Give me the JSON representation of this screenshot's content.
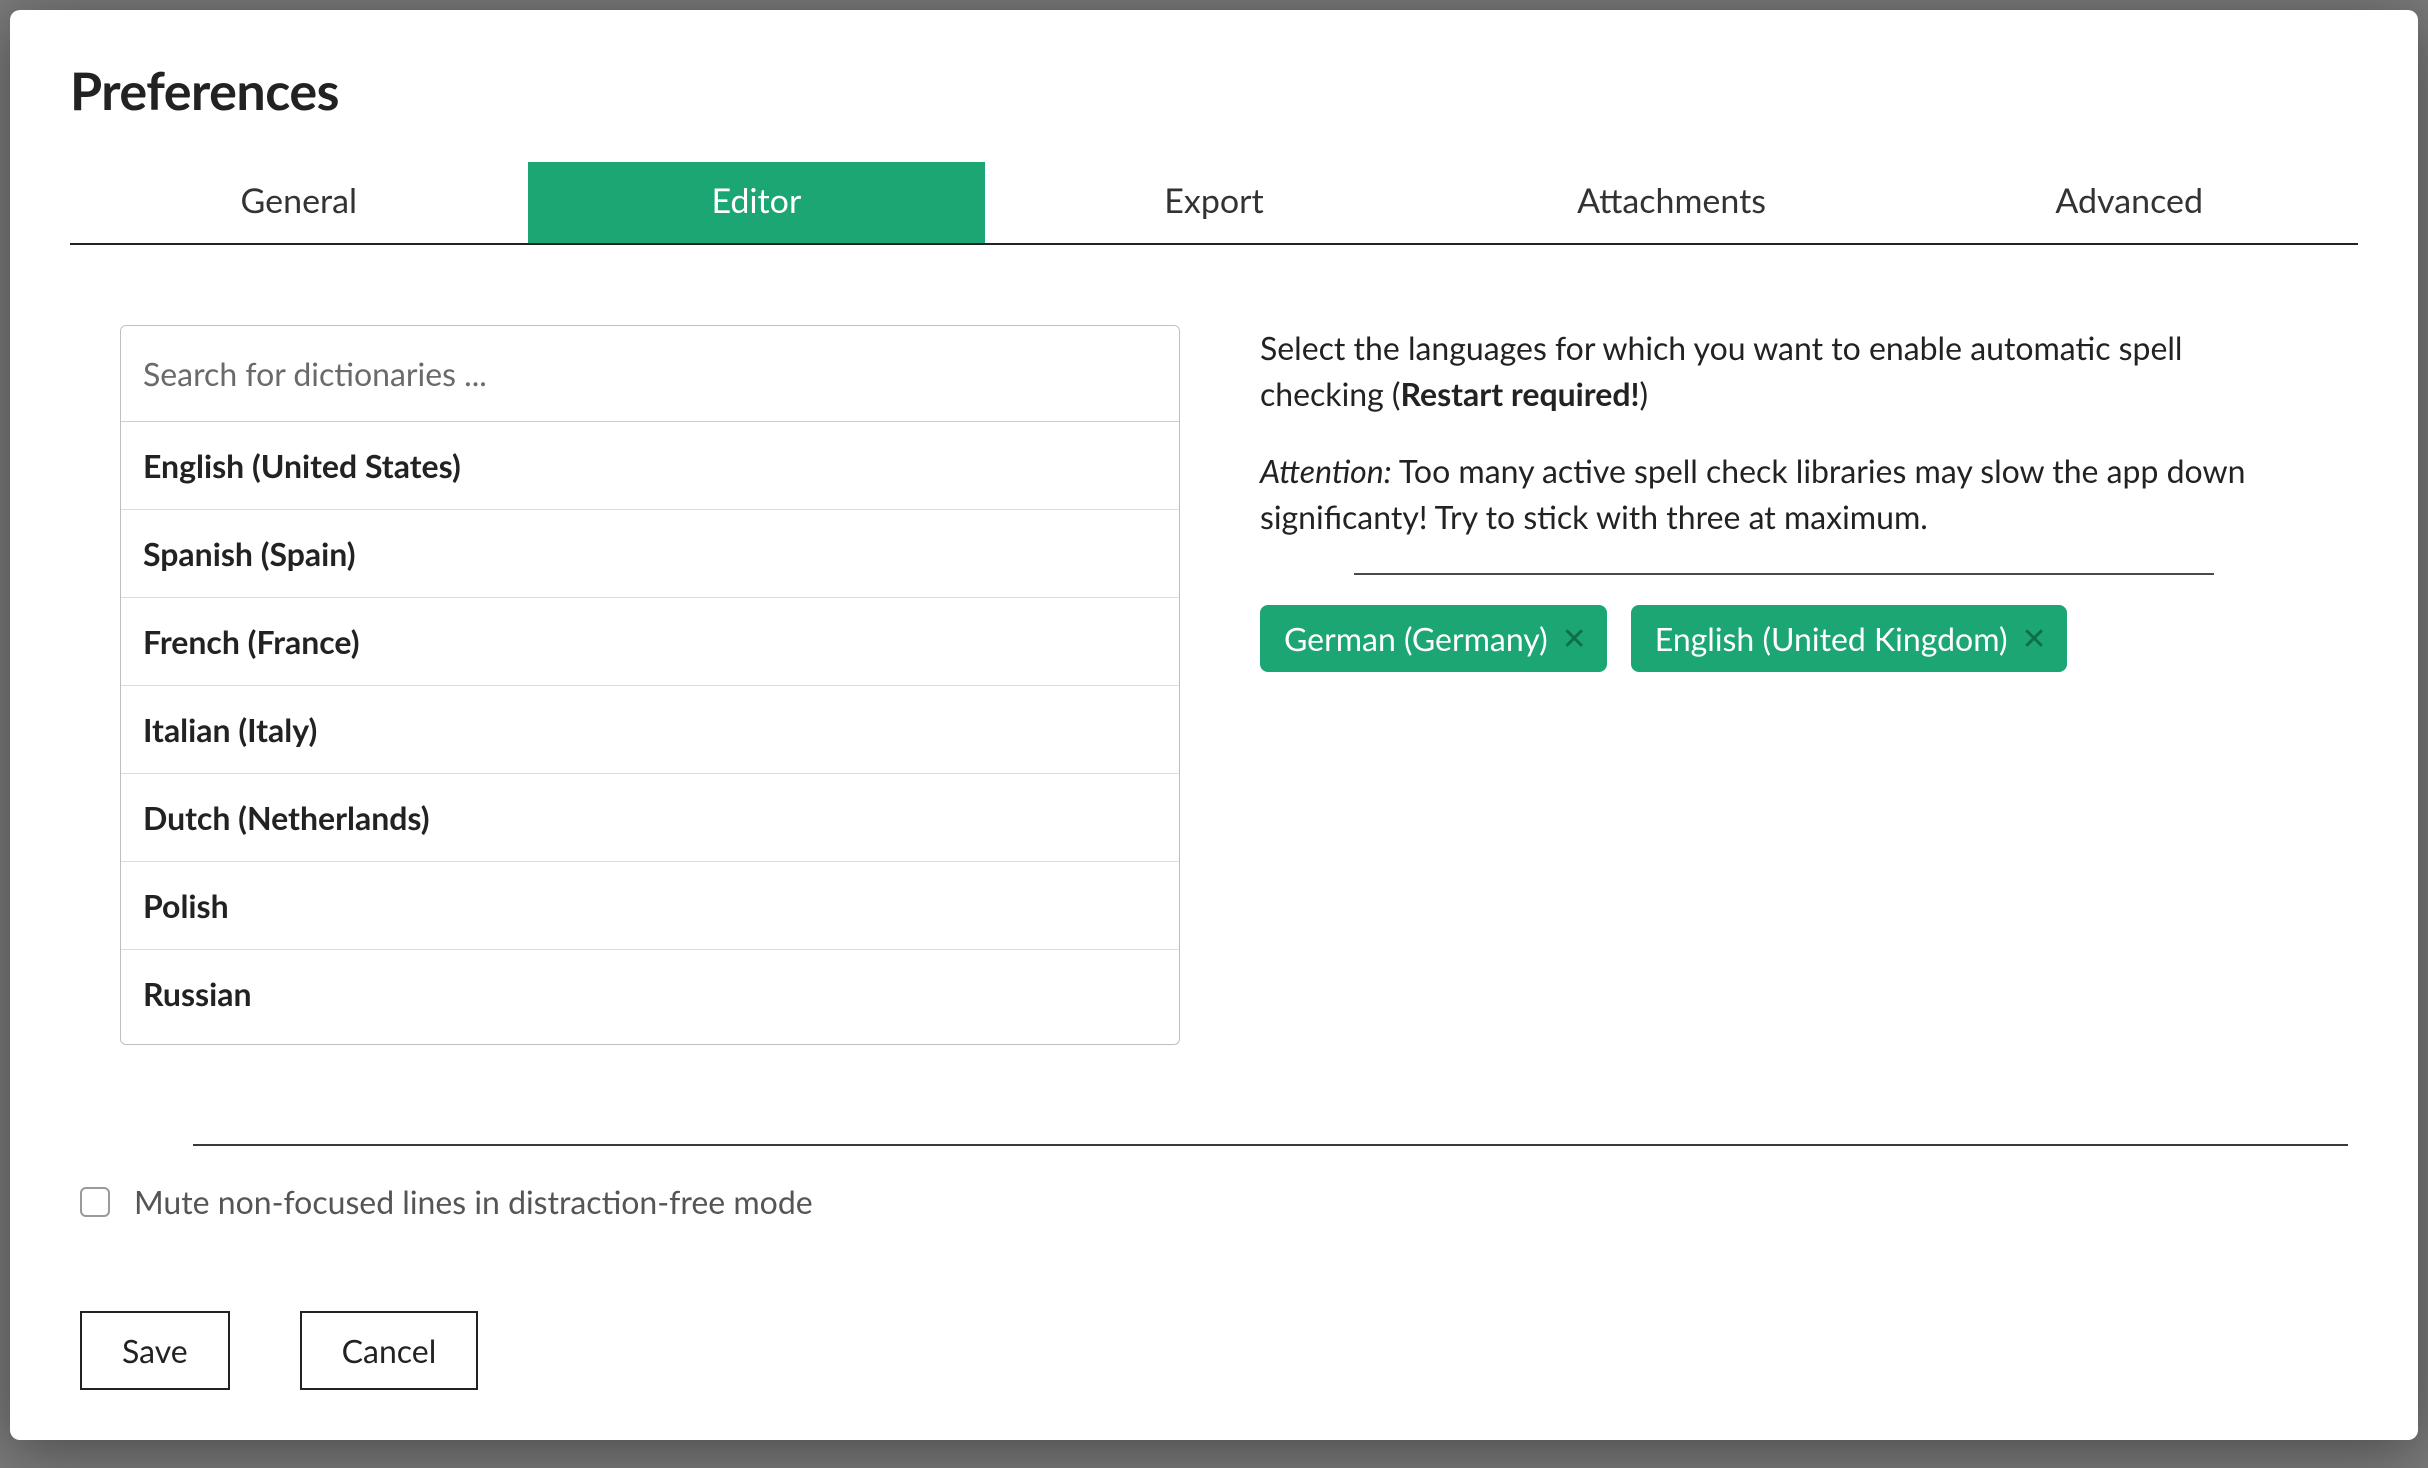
{
  "dialog": {
    "title": "Preferences"
  },
  "tabs": {
    "general": "General",
    "editor": "Editor",
    "export": "Export",
    "attachments": "Attachments",
    "advanced": "Advanced",
    "active": "editor"
  },
  "search": {
    "placeholder": "Search for dictionaries ...",
    "value": ""
  },
  "dictionaries": [
    "English (United States)",
    "Spanish (Spain)",
    "French (France)",
    "Italian (Italy)",
    "Dutch (Netherlands)",
    "Polish",
    "Russian"
  ],
  "info": {
    "line1_pre": "Select the languages for which you want to enable automatic spell checking (",
    "line1_strong": "Restart required!",
    "line1_post": ")",
    "attention_label": "Attention:",
    "attention_text": " Too many active spell check libraries may slow the app down significanty! Try to stick with three at maximum."
  },
  "selected": [
    "German (Germany)",
    "English (United Kingdom)"
  ],
  "mute": {
    "label": "Mute non-focused lines in distraction-free mode",
    "checked": false
  },
  "buttons": {
    "save": "Save",
    "cancel": "Cancel"
  }
}
